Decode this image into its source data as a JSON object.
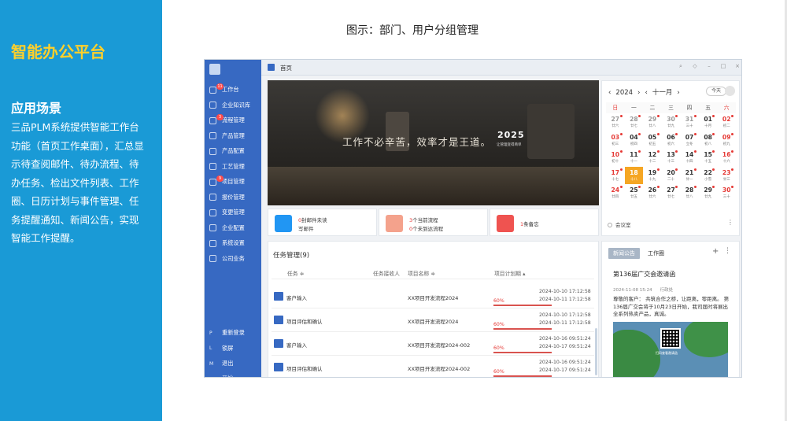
{
  "left": {
    "brand": "智能办公平台",
    "scene_title": "应用场景",
    "scene_desc": "三品PLM系统提供智能工作台功能（首页工作桌面），汇总显示待查阅邮件、待办流程、待办任务、检出文件列表、工作圈、日历计划与事件管理、任务提醒通知、新闻公告，实现智能工作提醒。"
  },
  "caption": "图示：部门、用户分组管理",
  "app": {
    "tab_title": "首页",
    "window_controls": [
      "⌕",
      "◇",
      "–",
      "□",
      "×"
    ],
    "sidebar": [
      {
        "label": "工作台",
        "badge": "11",
        "icon": "monitor-icon"
      },
      {
        "label": "企业知识库",
        "badge": "",
        "icon": "book-icon"
      },
      {
        "label": "流程管理",
        "badge": "3",
        "icon": "flow-icon"
      },
      {
        "label": "产品管理",
        "badge": "",
        "icon": "cube-icon"
      },
      {
        "label": "产品配置",
        "badge": "",
        "icon": "sliders-icon"
      },
      {
        "label": "工艺管理",
        "badge": "",
        "icon": "wrench-icon"
      },
      {
        "label": "项目管理",
        "badge": "9",
        "icon": "project-icon"
      },
      {
        "label": "报价管理",
        "badge": "",
        "icon": "quote-icon"
      },
      {
        "label": "变更管理",
        "badge": "",
        "icon": "change-icon"
      },
      {
        "label": "企业配置",
        "badge": "",
        "icon": "org-icon"
      },
      {
        "label": "系统设置",
        "badge": "",
        "icon": "gear-icon"
      },
      {
        "label": "公司业务",
        "badge": "",
        "icon": "grid-icon"
      }
    ],
    "sidebar_bottom": [
      {
        "key": "P",
        "label": "重新登录"
      },
      {
        "key": "L",
        "label": "锁屏"
      },
      {
        "key": "M",
        "label": "退出"
      }
    ],
    "sidebar_cut": "开始",
    "banner": {
      "slogan": "工作不必辛苦，效率才是王道。",
      "year": "2025",
      "year_sub": "让管理变得简单"
    },
    "stats": [
      {
        "n1": "0",
        "t1": "封邮件未读",
        "t2": "写邮件",
        "color": "#2196f3",
        "icon": "mail-icon"
      },
      {
        "n1": "3",
        "t1": "个当前流程",
        "n2": "0",
        "t2": "个未到达流程",
        "color": "#f4a28c",
        "icon": "flow-doc-icon"
      },
      {
        "n1": "1",
        "t1": "条备忘",
        "color": "#ef5350",
        "icon": "memo-icon"
      }
    ],
    "calendar": {
      "year": "2024",
      "month": "十一月",
      "today_label": "今天",
      "weekdays": [
        "日",
        "一",
        "二",
        "三",
        "四",
        "五",
        "六"
      ],
      "weeks": [
        [
          {
            "d": "27",
            "l": "廿六",
            "dim": true,
            "dot": true
          },
          {
            "d": "28",
            "l": "廿七",
            "dim": true,
            "dot": true
          },
          {
            "d": "29",
            "l": "廿八",
            "dim": true,
            "dot": true
          },
          {
            "d": "30",
            "l": "廿九",
            "dim": true,
            "dot": true
          },
          {
            "d": "31",
            "l": "三十",
            "dim": true,
            "dot": true
          },
          {
            "d": "01",
            "l": "十月",
            "dot": true
          },
          {
            "d": "02",
            "l": "初二",
            "dot": true
          }
        ],
        [
          {
            "d": "03",
            "l": "初三",
            "dot": true
          },
          {
            "d": "04",
            "l": "初四",
            "dot": true
          },
          {
            "d": "05",
            "l": "初五",
            "dot": true
          },
          {
            "d": "06",
            "l": "初六",
            "dot": true
          },
          {
            "d": "07",
            "l": "立冬",
            "dot": true
          },
          {
            "d": "08",
            "l": "初八",
            "dot": true
          },
          {
            "d": "09",
            "l": "初九",
            "dot": true
          }
        ],
        [
          {
            "d": "10",
            "l": "初十",
            "dot": true
          },
          {
            "d": "11",
            "l": "十一",
            "dot": true
          },
          {
            "d": "12",
            "l": "十二",
            "dot": true
          },
          {
            "d": "13",
            "l": "十三",
            "dot": true
          },
          {
            "d": "14",
            "l": "十四",
            "dot": true
          },
          {
            "d": "15",
            "l": "十五",
            "dot": true
          },
          {
            "d": "16",
            "l": "十六",
            "dot": true
          }
        ],
        [
          {
            "d": "17",
            "l": "十七",
            "dot": true
          },
          {
            "d": "18",
            "l": "十八",
            "sel": true
          },
          {
            "d": "19",
            "l": "十九",
            "dot": true
          },
          {
            "d": "20",
            "l": "二十",
            "dot": true
          },
          {
            "d": "21",
            "l": "廿一",
            "dot": true
          },
          {
            "d": "22",
            "l": "小雪",
            "dot": true
          },
          {
            "d": "23",
            "l": "廿三",
            "dot": true
          }
        ],
        [
          {
            "d": "24",
            "l": "廿四",
            "dot": true
          },
          {
            "d": "25",
            "l": "廿五",
            "dot": true
          },
          {
            "d": "26",
            "l": "廿六",
            "dot": true
          },
          {
            "d": "27",
            "l": "廿七",
            "dot": true
          },
          {
            "d": "28",
            "l": "廿八",
            "dot": true
          },
          {
            "d": "29",
            "l": "廿九",
            "dot": true
          },
          {
            "d": "30",
            "l": "三十",
            "dot": true
          }
        ]
      ],
      "meeting": "会议室"
    },
    "tasks": {
      "title": "任务管理(9)",
      "headers": {
        "task": "任务 ≑",
        "receiver": "任务接收人",
        "project": "项目名称 ≑",
        "plan": "项目计划期 ▴"
      },
      "rows": [
        {
          "name": "客户输入",
          "project": "XX项目开发流程2024",
          "pct": "60%",
          "start": "2024-10-10 17:12:58",
          "end": "2024-10-11 17:12:58"
        },
        {
          "name": "项目评估和确认",
          "project": "XX项目开发流程2024",
          "pct": "60%",
          "start": "2024-10-10 17:12:58",
          "end": "2024-10-11 17:12:58"
        },
        {
          "name": "客户输入",
          "project": "XX项目开发流程2024-002",
          "pct": "60%",
          "start": "2024-10-16 09:51:24",
          "end": "2024-10-17 09:51:24"
        },
        {
          "name": "项目评估和确认",
          "project": "XX项目开发流程2024-002",
          "pct": "60%",
          "start": "2024-10-16 09:51:24",
          "end": "2024-10-17 09:51:24"
        }
      ]
    },
    "news": {
      "tab_news": "新闻公告",
      "tab_circle": "工作圈",
      "plus": "+",
      "more": "⋮",
      "headline": "第136届广交会邀请函",
      "date": "2024-11-08 15:24",
      "source": "行政处",
      "body": "尊敬的客户：    共筑合作之桥，让距离，零距离。    第136届广交会将于10月23日开始，我司届时将展出全系列热卖产品，真诚。",
      "img_caption": "扫码查看邀请函"
    }
  },
  "colors": {
    "left_panel": "#1a9ad6",
    "brand": "#ffd02b",
    "sidebar": "#3769c2",
    "selected_day": "#f5a623",
    "alert_red": "#e53935"
  }
}
